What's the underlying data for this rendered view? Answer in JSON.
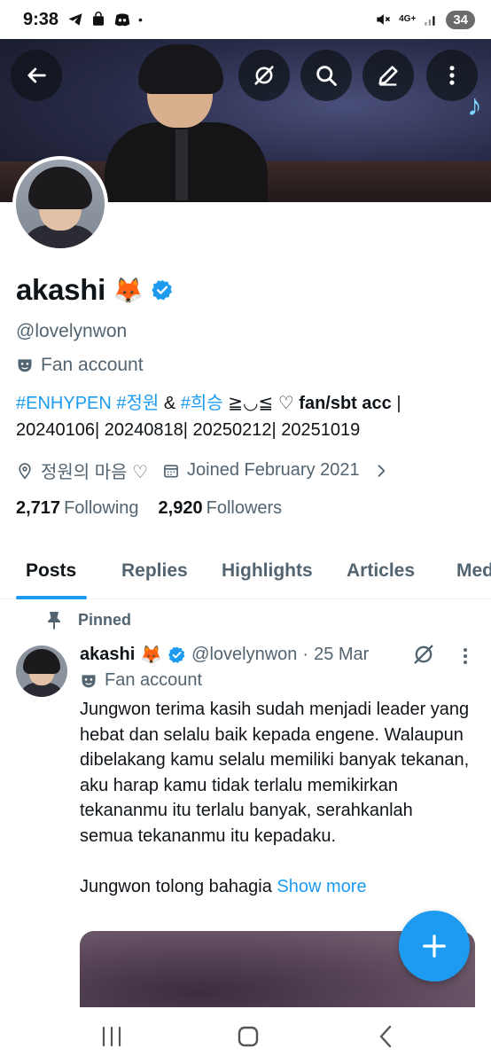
{
  "status_bar": {
    "time": "9:38",
    "network": "4G+",
    "battery": "34"
  },
  "profile": {
    "display_name": "akashi",
    "name_emoji": "🦊",
    "handle": "@lovelynwon",
    "account_label": "Fan account",
    "bio": {
      "tag1": "#ENHYPEN",
      "tag2": "#정원",
      "amp": " & ",
      "tag3": "#희승",
      "bio_rest": " ≧◡≦ ♡ ",
      "bio_bold": "fan/sbt acc",
      "bio_line2": " | 20240106| 20240818| 20250212| 20251019"
    },
    "location": "정원의 마음 ♡",
    "joined": "Joined February 2021",
    "following_count": "2,717",
    "following_label": "Following",
    "followers_count": "2,920",
    "followers_label": "Followers"
  },
  "tabs": [
    {
      "label": "Posts",
      "active": true
    },
    {
      "label": "Replies",
      "active": false
    },
    {
      "label": "Highlights",
      "active": false
    },
    {
      "label": "Articles",
      "active": false
    },
    {
      "label": "Med",
      "active": false
    }
  ],
  "pinned_tweet": {
    "pinned_label": "Pinned",
    "author_name": "akashi",
    "author_emoji": "🦊",
    "author_handle": "@lovelynwon",
    "separator": "·",
    "date": "25 Mar",
    "account_label": "Fan account",
    "paragraph1": "Jungwon terima kasih sudah menjadi leader yang hebat dan selalu baik kepada engene. Walaupun dibelakang kamu selalu memiliki banyak tekanan, aku harap kamu tidak terlalu memikirkan tekananmu itu terlalu banyak, serahkanlah semua tekananmu itu kepadaku.",
    "paragraph2": "Jungwon tolong bahagia",
    "show_more": "Show more"
  },
  "colors": {
    "accent": "#1d9bf0",
    "text_primary": "#0f1419",
    "text_secondary": "#536471"
  },
  "icons": {
    "header": [
      "back-arrow-icon",
      "grok-icon",
      "search-icon",
      "edit-icon",
      "more-vertical-icon"
    ],
    "nav": [
      "recents-icon",
      "home-icon",
      "back-icon"
    ]
  }
}
